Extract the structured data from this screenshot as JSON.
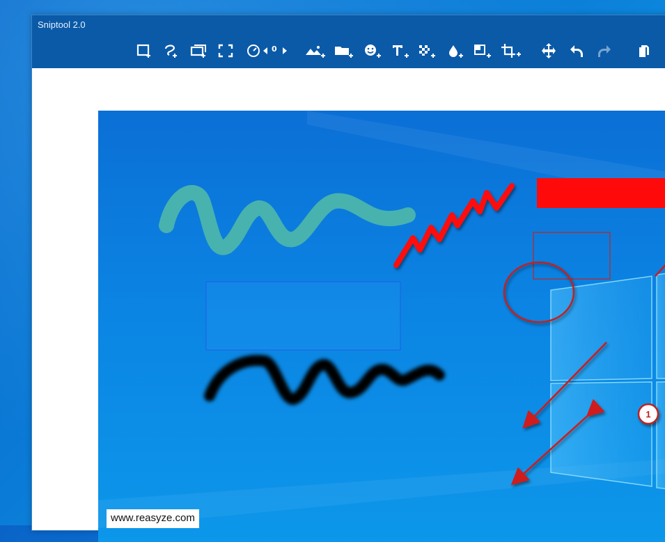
{
  "window": {
    "title": "Sniptool 2.0"
  },
  "toolbar": {
    "zoom_value": "0",
    "tools": [
      {
        "name": "rectangle-snip-icon"
      },
      {
        "name": "freeform-snip-icon"
      },
      {
        "name": "window-snip-icon"
      },
      {
        "name": "fullscreen-snip-icon"
      },
      {
        "name": "delay-timer-icon"
      },
      {
        "name": "image-icon"
      },
      {
        "name": "folder-icon"
      },
      {
        "name": "emoji-icon"
      },
      {
        "name": "text-icon"
      },
      {
        "name": "blur-icon"
      },
      {
        "name": "color-drop-icon"
      },
      {
        "name": "shadow-icon"
      },
      {
        "name": "crop-icon"
      },
      {
        "name": "move-icon"
      },
      {
        "name": "undo-icon"
      },
      {
        "name": "redo-icon"
      },
      {
        "name": "copy-icon"
      }
    ]
  },
  "annotations": {
    "step_number": "1"
  },
  "watermark": {
    "text": "www.reasyze.com"
  },
  "colors": {
    "titlebar": "#0a5aa8",
    "highlighter": "#4fb8a8",
    "pen_red": "#ff1010",
    "pen_black": "#000000",
    "arrow_red": "#d01c1c",
    "shape_blue": "#1f5ee8"
  }
}
